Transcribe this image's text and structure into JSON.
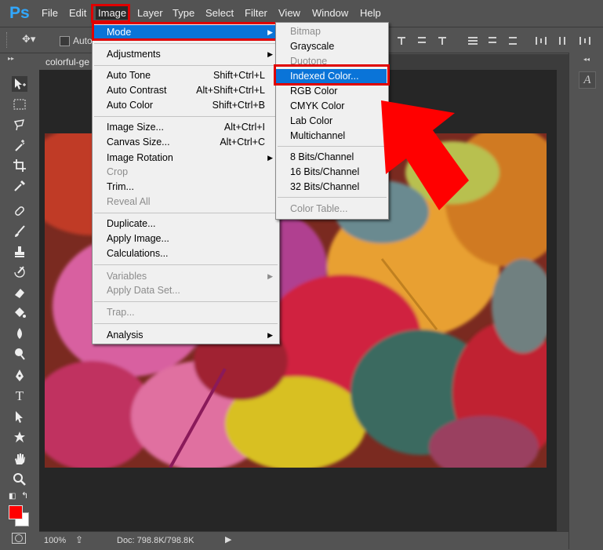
{
  "app": {
    "logo": "Ps"
  },
  "menubar": {
    "items": [
      "File",
      "Edit",
      "Image",
      "Layer",
      "Type",
      "Select",
      "Filter",
      "View",
      "Window",
      "Help"
    ]
  },
  "options": {
    "auto_label": "Auto"
  },
  "document": {
    "tab_title": "colorful-ge"
  },
  "status": {
    "zoom": "100%",
    "doc_info": "Doc: 798.8K/798.8K"
  },
  "image_menu": {
    "mode": "Mode",
    "adjustments": "Adjustments",
    "auto_tone": "Auto Tone",
    "auto_tone_sc": "Shift+Ctrl+L",
    "auto_contrast": "Auto Contrast",
    "auto_contrast_sc": "Alt+Shift+Ctrl+L",
    "auto_color": "Auto Color",
    "auto_color_sc": "Shift+Ctrl+B",
    "image_size": "Image Size...",
    "image_size_sc": "Alt+Ctrl+I",
    "canvas_size": "Canvas Size...",
    "canvas_size_sc": "Alt+Ctrl+C",
    "image_rotation": "Image Rotation",
    "crop": "Crop",
    "trim": "Trim...",
    "reveal_all": "Reveal All",
    "duplicate": "Duplicate...",
    "apply_image": "Apply Image...",
    "calculations": "Calculations...",
    "variables": "Variables",
    "apply_data_set": "Apply Data Set...",
    "trap": "Trap...",
    "analysis": "Analysis"
  },
  "mode_menu": {
    "bitmap": "Bitmap",
    "grayscale": "Grayscale",
    "duotone": "Duotone",
    "indexed": "Indexed Color...",
    "rgb": "RGB Color",
    "cmyk": "CMYK Color",
    "lab": "Lab Color",
    "multichannel": "Multichannel",
    "bits8": "8 Bits/Channel",
    "bits16": "16 Bits/Channel",
    "bits32": "32 Bits/Channel",
    "color_table": "Color Table..."
  },
  "colors": {
    "accent_red": "#e00000",
    "highlight": "#0a74d8",
    "foreground": "#ff0000"
  }
}
